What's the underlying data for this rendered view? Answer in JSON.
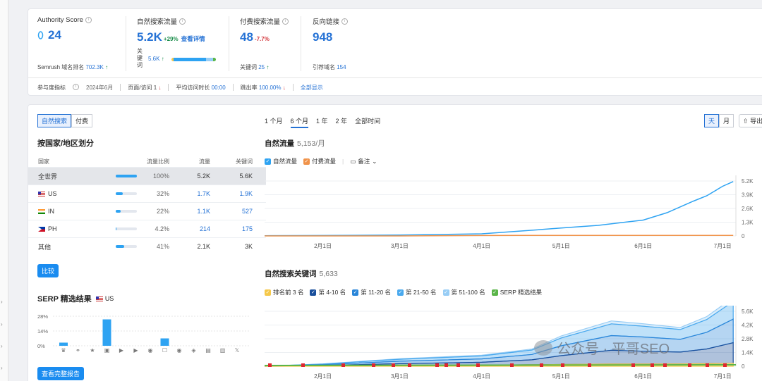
{
  "metrics": {
    "authority": {
      "title": "Authority Score",
      "value": "24",
      "sub_label": "Semrush 域名排名",
      "sub_value": "702.3K",
      "sub_arrow": "↑"
    },
    "organic": {
      "title": "自然搜索流量",
      "value": "5.2K",
      "change": "+29%",
      "link": "查看详情",
      "kw_label": "关\n键\n词",
      "kw_value": "5.6K",
      "kw_arrow": "↑"
    },
    "paid": {
      "title": "付费搜索流量",
      "value": "48",
      "change": "-7.7%",
      "sub_label": "关键词",
      "sub_value": "25",
      "sub_arrow": "↑"
    },
    "backlinks": {
      "title": "反向链接",
      "value": "948",
      "sub_label": "引荐域名",
      "sub_value": "154"
    }
  },
  "engagement": {
    "label": "参与度指标",
    "month": "2024年6月",
    "pages_label": "页面/访问",
    "pages_value": "1",
    "pages_arrow": "↓",
    "duration_label": "平均访问时长",
    "duration_value": "00:00",
    "bounce_label": "跳出率",
    "bounce_value": "100.00%",
    "bounce_arrow": "↓",
    "show_all": "全部显示"
  },
  "left": {
    "tabs": [
      "自然搜索",
      "付费"
    ],
    "country_title": "按国家/地区划分",
    "table_head": [
      "国家",
      "流量比例",
      "流量",
      "关键词"
    ],
    "rows": [
      {
        "name": "全世界",
        "flag": "",
        "share": 100,
        "pct": "100%",
        "traffic": "5.2K",
        "kw": "5.6K"
      },
      {
        "name": "US",
        "flag": "us",
        "share": 32,
        "pct": "32%",
        "traffic": "1.7K",
        "kw": "1.9K"
      },
      {
        "name": "IN",
        "flag": "in",
        "share": 22,
        "pct": "22%",
        "traffic": "1.1K",
        "kw": "527"
      },
      {
        "name": "PH",
        "flag": "ph",
        "share": 4.2,
        "pct": "4.2%",
        "traffic": "214",
        "kw": "175"
      },
      {
        "name": "其他",
        "flag": "",
        "share": 41,
        "pct": "41%",
        "traffic": "2.1K",
        "kw": "3K"
      }
    ],
    "compare_btn": "比较",
    "serp_title": "SERP 精选结果",
    "serp_country": "US",
    "serp_yticks": [
      "28%",
      "14%",
      "0%"
    ],
    "serp_values": [
      3,
      0,
      0,
      25,
      0,
      0,
      0,
      7,
      0,
      0,
      0,
      0,
      0
    ],
    "serp_icons": [
      "crown-icon",
      "link-icon",
      "star-icon",
      "image-icon",
      "video-icon",
      "play-icon",
      "carousel-icon",
      "comment-icon",
      "location-icon",
      "graduation-icon",
      "doc-icon",
      "shop-icon",
      "x-icon"
    ],
    "report_btn": "查看完整报告"
  },
  "right": {
    "periods": [
      "1 个月",
      "6 个月",
      "1 年",
      "2 年",
      "全部时间"
    ],
    "granularity": [
      "天",
      "月"
    ],
    "export": "导出",
    "traffic_title": "自然流量",
    "traffic_count": "5,153/月",
    "traffic_legend": [
      "自然流量",
      "付费流量"
    ],
    "notes": "备注",
    "traffic_yticks": [
      "5.2K",
      "3.9K",
      "2.6K",
      "1.3K",
      "0"
    ],
    "xticks": [
      "2月1日",
      "3月1日",
      "4月1日",
      "5月1日",
      "6月1日",
      "7月1日"
    ],
    "kw_title": "自然搜索关键词",
    "kw_count": "5,633",
    "kw_legend": [
      "排名前 3 名",
      "第 4-10 名",
      "第 11-20 名",
      "第 21-50 名",
      "第 51-100 名",
      "SERP 精选结果"
    ],
    "kw_colors": [
      "#f5c84a",
      "#1a4f9c",
      "#2a86d9",
      "#49a9ee",
      "#98cdf5",
      "#5ab548"
    ],
    "kw_yticks": [
      "5.6K",
      "4.2K",
      "2.8K",
      "1.4K",
      "0"
    ],
    "watermark": "公众号 · 平哥SEO"
  },
  "chart_data": [
    {
      "type": "line",
      "title": "自然流量",
      "x": [
        "2024-01-10",
        "2024-02-01",
        "2024-03-01",
        "2024-04-01",
        "2024-04-15",
        "2024-05-01",
        "2024-05-15",
        "2024-06-01",
        "2024-06-10",
        "2024-06-20",
        "2024-06-25",
        "2024-07-01",
        "2024-07-05"
      ],
      "series": [
        {
          "name": "自然流量",
          "values": [
            20,
            40,
            80,
            200,
            450,
            750,
            1000,
            1500,
            2200,
            3300,
            3800,
            4700,
            5150
          ]
        },
        {
          "name": "付费流量",
          "values": [
            0,
            0,
            0,
            40,
            45,
            48,
            48,
            48,
            48,
            48,
            48,
            48,
            48
          ]
        }
      ],
      "ylim": [
        0,
        5200
      ]
    },
    {
      "type": "area",
      "title": "自然搜索关键词",
      "x": [
        "2024-01-10",
        "2024-02-01",
        "2024-03-01",
        "2024-04-01",
        "2024-04-20",
        "2024-05-01",
        "2024-05-20",
        "2024-06-01",
        "2024-06-15",
        "2024-06-25",
        "2024-07-05"
      ],
      "series": [
        {
          "name": "排名前 3 名",
          "values": [
            0,
            20,
            60,
            100,
            150,
            180,
            220,
            230,
            240,
            260,
            300
          ]
        },
        {
          "name": "第 4-10 名",
          "values": [
            0,
            60,
            200,
            300,
            500,
            900,
            1400,
            1300,
            1200,
            1500,
            2100
          ]
        },
        {
          "name": "第 11-20 名",
          "values": [
            0,
            80,
            250,
            350,
            550,
            1000,
            1500,
            1450,
            1300,
            1700,
            2400
          ]
        },
        {
          "name": "第 21-50 名",
          "values": [
            0,
            60,
            200,
            300,
            450,
            800,
            1200,
            1100,
            1000,
            1300,
            1800
          ]
        },
        {
          "name": "第 51-100 名",
          "values": [
            0,
            20,
            60,
            80,
            100,
            200,
            300,
            250,
            200,
            300,
            400
          ]
        }
      ],
      "ylim": [
        0,
        5600
      ]
    }
  ]
}
